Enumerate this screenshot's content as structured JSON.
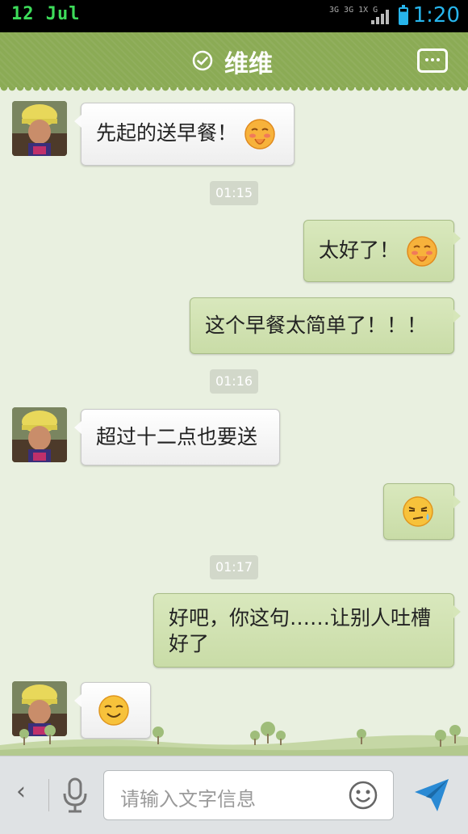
{
  "status_bar": {
    "date": "12  Jul",
    "network_1": "3G 3G 1X G",
    "time": "1:20",
    "battery_icon": "battery-icon",
    "signal_icon": "signal-icon"
  },
  "header": {
    "title": "维维",
    "verified_icon": "check-circle-icon",
    "more_icon": "more-dots-icon"
  },
  "messages": [
    {
      "side": "in",
      "text": "先起的送早餐！",
      "emoji": "blush-emoji"
    },
    {
      "type": "timestamp",
      "text": "01:15"
    },
    {
      "side": "out",
      "text": "太好了！",
      "emoji": "blush-emoji"
    },
    {
      "side": "out",
      "text": "这个早餐太简单了！！！"
    },
    {
      "type": "timestamp",
      "text": "01:16"
    },
    {
      "side": "in",
      "text": "超过十二点也要送"
    },
    {
      "side": "out",
      "text": "",
      "emoji": "sweat-emoji"
    },
    {
      "type": "timestamp",
      "text": "01:17"
    },
    {
      "side": "out",
      "text_line1": "好吧，你这句……让别人吐槽",
      "text_line2": "好了"
    },
    {
      "side": "in",
      "text": "",
      "emoji": "smile-emoji"
    }
  ],
  "input_bar": {
    "back_icon": "chevron-left-icon",
    "back_glyph": "‹",
    "mic_icon": "microphone-icon",
    "placeholder": "请输入文字信息",
    "smiley_icon": "smiley-icon",
    "send_icon": "send-icon"
  },
  "colors": {
    "header": "#8bab55",
    "chat_bg": "#e9f0e0",
    "out_bubble": "#d3e4b5",
    "in_bubble": "#ffffff",
    "time_accent": "#27b5ec",
    "date_accent": "#3ddc5a"
  }
}
